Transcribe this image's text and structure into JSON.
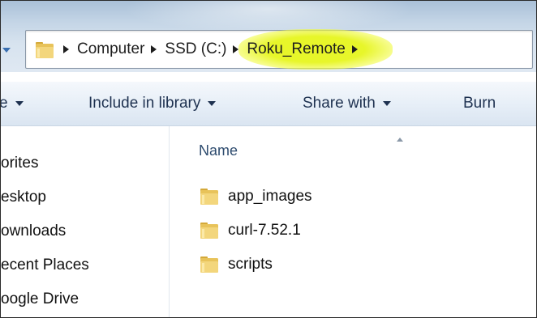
{
  "address": {
    "crumbs": [
      {
        "label": "Computer"
      },
      {
        "label": "SSD (C:)"
      },
      {
        "label": "Roku_Remote"
      }
    ]
  },
  "toolbar": {
    "partial_left_label": "e",
    "include_label": "Include in library",
    "share_label": "Share with",
    "burn_label": "Burn"
  },
  "nav": {
    "items": [
      "orites",
      "esktop",
      "ownloads",
      "ecent Places",
      "oogle Drive"
    ]
  },
  "content": {
    "column_header": "Name",
    "files": [
      "app_images",
      "curl-7.52.1",
      "scripts"
    ]
  },
  "colors": {
    "highlight": "#eef52a",
    "folder": "#e8c35a",
    "toolbar_text": "#1e3150"
  }
}
